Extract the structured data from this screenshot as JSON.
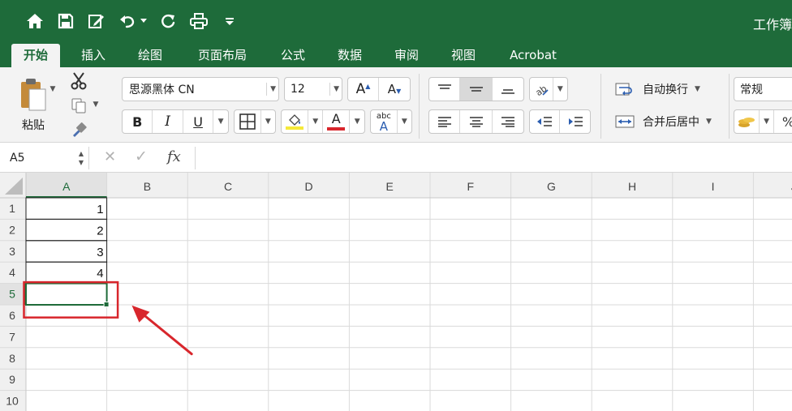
{
  "titlebar": {
    "workbook_title": "工作簿",
    "qat_items": [
      {
        "name": "home-icon"
      },
      {
        "name": "save-icon"
      },
      {
        "name": "edit-icon"
      },
      {
        "name": "undo-icon"
      },
      {
        "name": "redo-icon"
      },
      {
        "name": "print-icon"
      }
    ]
  },
  "tabs": [
    {
      "label": "开始",
      "active": true
    },
    {
      "label": "插入"
    },
    {
      "label": "绘图"
    },
    {
      "label": "页面布局"
    },
    {
      "label": "公式"
    },
    {
      "label": "数据"
    },
    {
      "label": "审阅"
    },
    {
      "label": "视图"
    },
    {
      "label": "Acrobat"
    }
  ],
  "ribbon": {
    "paste_label": "粘贴",
    "font_name": "思源黑体 CN",
    "font_size": "12",
    "increase_font_label": "A",
    "decrease_font_label": "A",
    "bold_label": "B",
    "italic_label": "I",
    "underline_label": "U",
    "font_color_label": "A",
    "abc_label": "abc",
    "wrap_text_label": "自动换行",
    "merge_center_label": "合并后居中",
    "number_format": "常规",
    "fill_color": "#f5e93a",
    "font_color": "#d8262c"
  },
  "formula_bar": {
    "name_box": "A5",
    "cancel_symbol": "✕",
    "confirm_symbol": "✓",
    "fx_label": "fx",
    "formula": ""
  },
  "sheet": {
    "columns": [
      "A",
      "B",
      "C",
      "D",
      "E",
      "F",
      "G",
      "H",
      "I",
      "J"
    ],
    "rows": [
      "1",
      "2",
      "3",
      "4",
      "5",
      "6",
      "7",
      "8",
      "9",
      "10"
    ],
    "active_cell": "A5",
    "cells": [
      {
        "ref": "A1",
        "col": 0,
        "row": 0,
        "value": "1"
      },
      {
        "ref": "A2",
        "col": 0,
        "row": 1,
        "value": "2"
      },
      {
        "ref": "A3",
        "col": 0,
        "row": 2,
        "value": "3"
      },
      {
        "ref": "A4",
        "col": 0,
        "row": 3,
        "value": "4"
      }
    ]
  },
  "colors": {
    "excel_green": "#1e6b3a",
    "ribbon_bg": "#f3f3f3",
    "grid_line": "#dadada",
    "header_bg": "#f0f0f0",
    "annotation_red": "#d8262c"
  }
}
